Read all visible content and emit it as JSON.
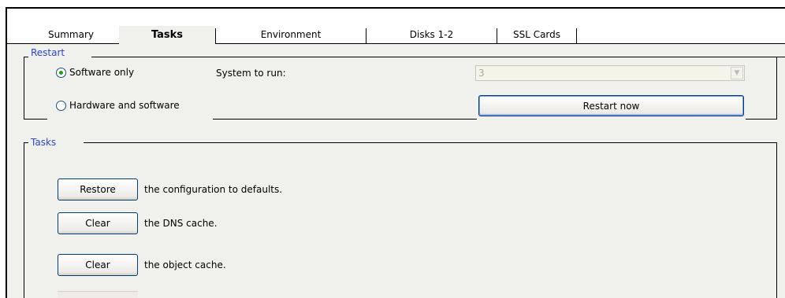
{
  "tabs": [
    {
      "label": "Summary",
      "active": false
    },
    {
      "label": "Tasks",
      "active": true
    },
    {
      "label": "Environment",
      "active": false
    },
    {
      "label": "Disks 1-2",
      "active": false
    },
    {
      "label": "SSL Cards",
      "active": false
    }
  ],
  "restart": {
    "legend": "Restart",
    "option_software": "Software only",
    "option_hardware": "Hardware and software",
    "selected": "software",
    "system_label": "System to run:",
    "system_value": "3",
    "restart_button": "Restart now"
  },
  "tasks": {
    "legend": "Tasks",
    "items": [
      {
        "button": "Restore",
        "text": "the configuration to defaults."
      },
      {
        "button": "Clear",
        "text": "the DNS cache."
      },
      {
        "button": "Clear",
        "text": "the object cache."
      }
    ]
  }
}
